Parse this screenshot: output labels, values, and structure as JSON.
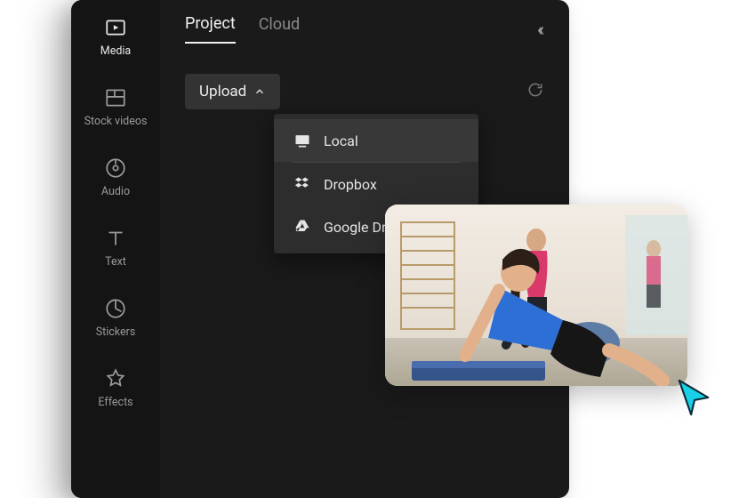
{
  "sidebar": {
    "items": [
      {
        "label": "Media"
      },
      {
        "label": "Stock videos"
      },
      {
        "label": "Audio"
      },
      {
        "label": "Text"
      },
      {
        "label": "Stickers"
      },
      {
        "label": "Effects"
      }
    ]
  },
  "tabs": {
    "project": "Project",
    "cloud": "Cloud"
  },
  "upload": {
    "button_label": "Upload",
    "options": {
      "local": "Local",
      "dropbox": "Dropbox",
      "google_drive": "Google Drive"
    }
  }
}
